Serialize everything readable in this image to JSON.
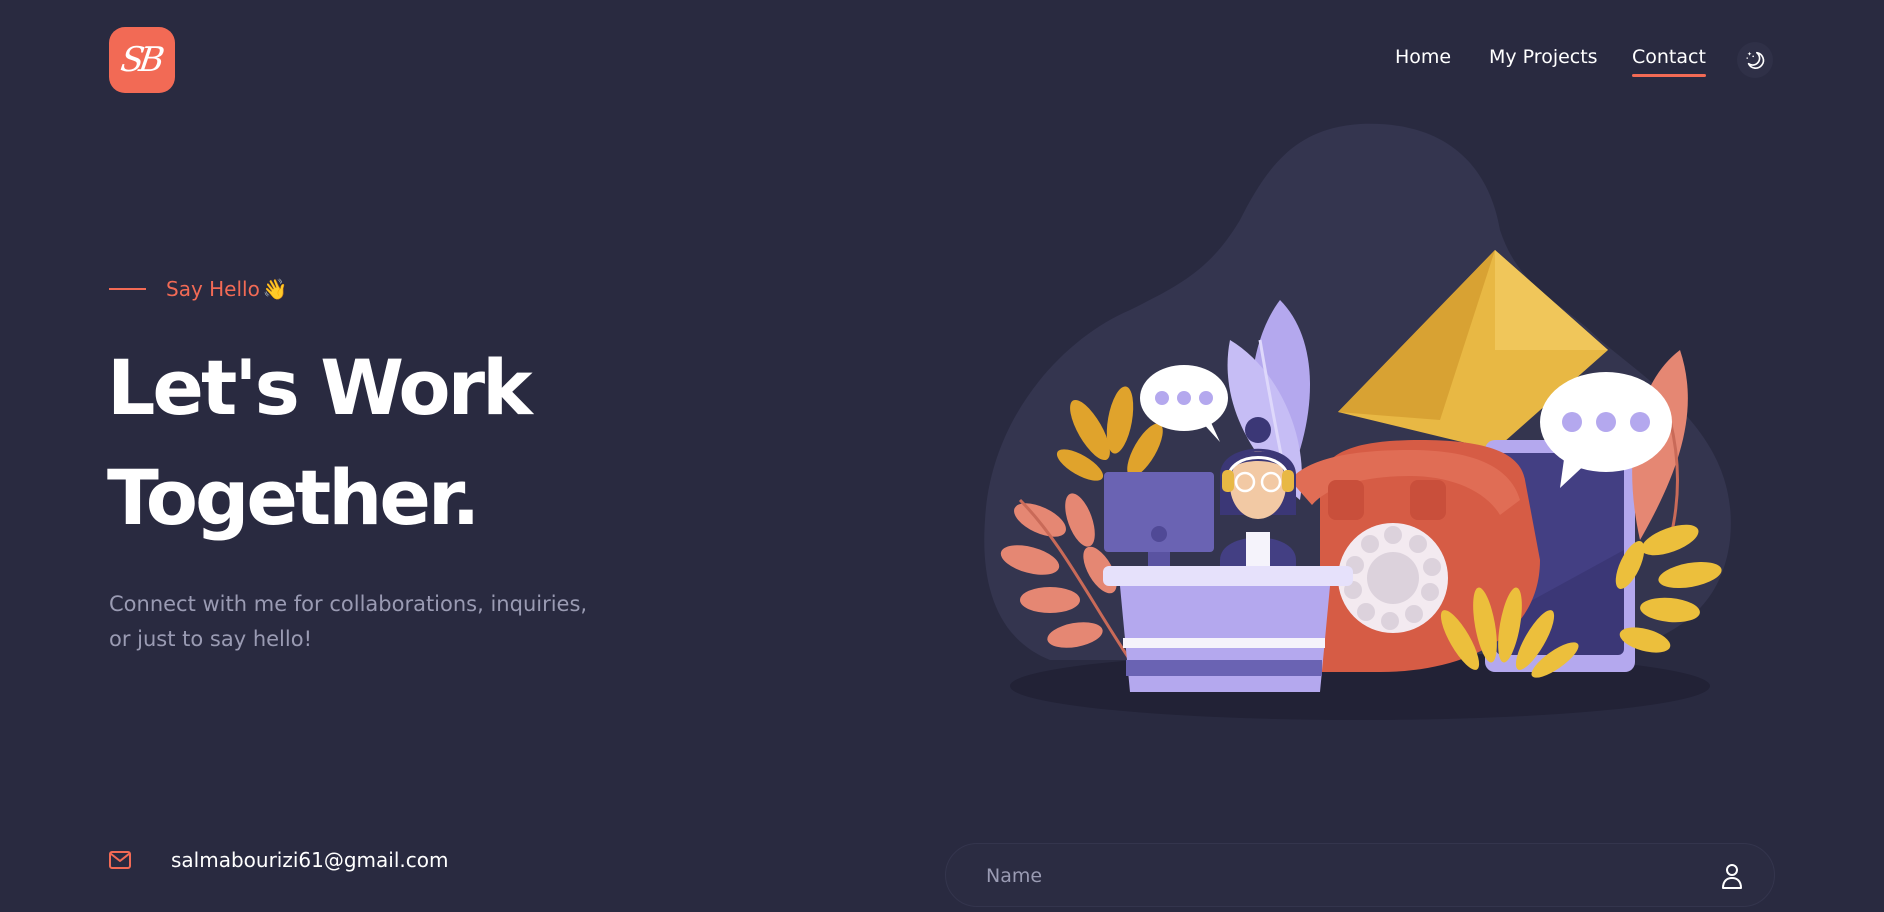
{
  "logo": {
    "text": "SB"
  },
  "nav": {
    "items": [
      {
        "label": "Home"
      },
      {
        "label": "My Projects"
      },
      {
        "label": "Contact",
        "active": true
      }
    ],
    "theme_toggle_icon": "moon-stars-icon"
  },
  "hero": {
    "eyebrow": "Say Hello",
    "eyebrow_emoji": "👋",
    "headline_line1": "Let's Work",
    "headline_line2": "Together.",
    "subtitle": "Connect with me for collaborations, inquiries, or just to say hello!"
  },
  "contact": {
    "email_icon": "mail-icon",
    "email": "salmabourizi61@gmail.com"
  },
  "form": {
    "name_placeholder": "Name",
    "name_icon": "user-icon"
  },
  "illustration": {
    "icon": "contact-illustration"
  },
  "colors": {
    "background": "#292a40",
    "accent": "#f26a55",
    "muted_text": "#9a9bb3",
    "blob": "#34354f"
  }
}
